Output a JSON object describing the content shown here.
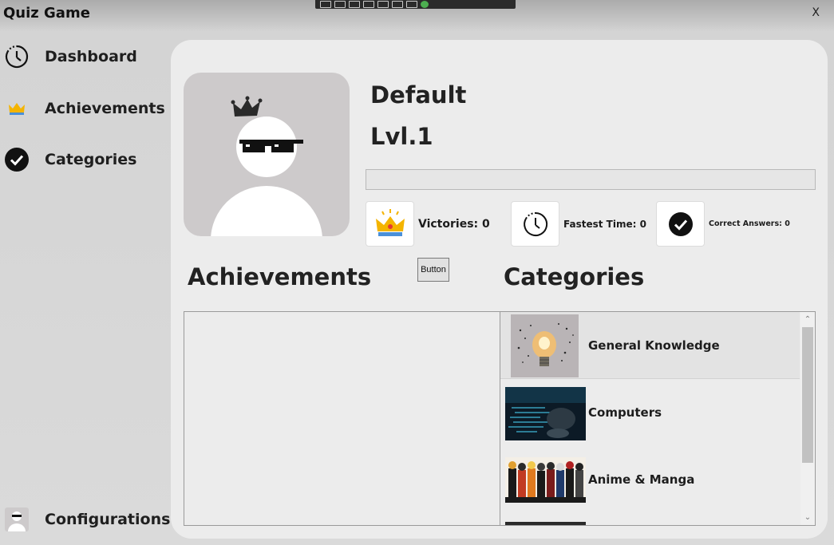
{
  "window": {
    "title": "Quiz Game",
    "close_label": "X"
  },
  "sidebar": {
    "items": [
      {
        "label": "Dashboard",
        "icon": "clock-icon"
      },
      {
        "label": "Achievements",
        "icon": "crown-icon"
      },
      {
        "label": "Categories",
        "icon": "checkmark-icon"
      }
    ],
    "footer": {
      "label": "Configurations",
      "icon": "avatar-icon"
    }
  },
  "profile": {
    "name": "Default",
    "level": "Lvl.1",
    "xp_fraction": 0
  },
  "stats": {
    "victories": "Victories: 0",
    "fastest_time": "Fastest Time: 0",
    "correct_answers": "Correct Answers: 0"
  },
  "button_label": "Button",
  "sections": {
    "achievements": "Achievements",
    "categories": "Categories"
  },
  "categories": [
    {
      "label": "General Knowledge",
      "selected": true
    },
    {
      "label": "Computers",
      "selected": false
    },
    {
      "label": "Anime & Manga",
      "selected": false
    }
  ],
  "colors": {
    "panel": "#ececec",
    "accent_check": "#111111",
    "crown_gold": "#f4b400"
  }
}
